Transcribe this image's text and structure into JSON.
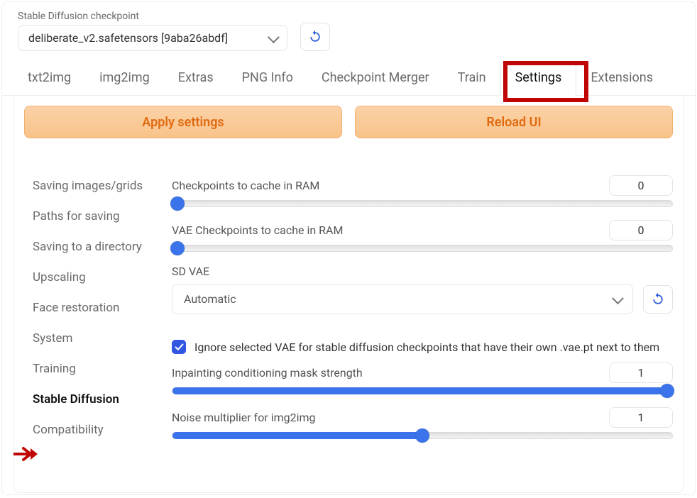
{
  "checkpoint": {
    "label": "Stable Diffusion checkpoint",
    "value": "deliberate_v2.safetensors [9aba26abdf]"
  },
  "tabs": [
    "txt2img",
    "img2img",
    "Extras",
    "PNG Info",
    "Checkpoint Merger",
    "Train",
    "Settings",
    "Extensions"
  ],
  "active_tab": "Settings",
  "buttons": {
    "apply": "Apply settings",
    "reload": "Reload UI"
  },
  "side_nav": [
    "Saving images/grids",
    "Paths for saving",
    "Saving to a directory",
    "Upscaling",
    "Face restoration",
    "System",
    "Training",
    "Stable Diffusion",
    "Compatibility"
  ],
  "active_side": "Stable Diffusion",
  "settings": {
    "ckpt_cache": {
      "label": "Checkpoints to cache in RAM",
      "value": "0"
    },
    "vae_cache": {
      "label": "VAE Checkpoints to cache in RAM",
      "value": "0"
    },
    "sd_vae": {
      "label": "SD VAE",
      "value": "Automatic"
    },
    "ignore_vae": {
      "label": "Ignore selected VAE for stable diffusion checkpoints that have their own .vae.pt next to them",
      "checked": true
    },
    "inpaint_mask": {
      "label": "Inpainting conditioning mask strength",
      "value": "1"
    },
    "noise_mult": {
      "label": "Noise multiplier for img2img",
      "value": "1"
    }
  }
}
